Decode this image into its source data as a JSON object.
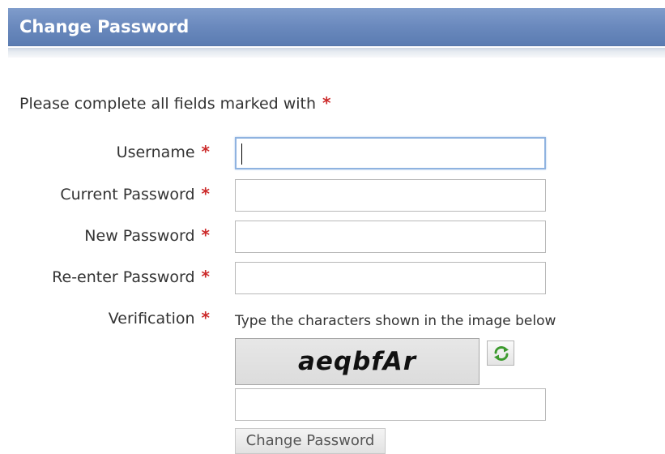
{
  "header": {
    "title": "Change Password"
  },
  "form": {
    "instructions": "Please complete all fields marked with",
    "required_marker": "*",
    "fields": [
      {
        "label": "Username",
        "value": "",
        "focused": true
      },
      {
        "label": "Current Password",
        "value": ""
      },
      {
        "label": "New Password",
        "value": ""
      },
      {
        "label": "Re-enter Password",
        "value": ""
      }
    ],
    "verification": {
      "label": "Verification",
      "hint": "Type the characters shown in the image below",
      "captcha_text": "aeqbfAr",
      "refresh_icon": "refresh-icon",
      "input_value": ""
    },
    "submit_label": "Change Password"
  },
  "colors": {
    "header_background": "#6a89bd",
    "header_text": "#ffffff",
    "required_marker": "#cc2b2b",
    "focus_border": "#8fb3e0",
    "refresh_icon": "#3c9a2e"
  }
}
